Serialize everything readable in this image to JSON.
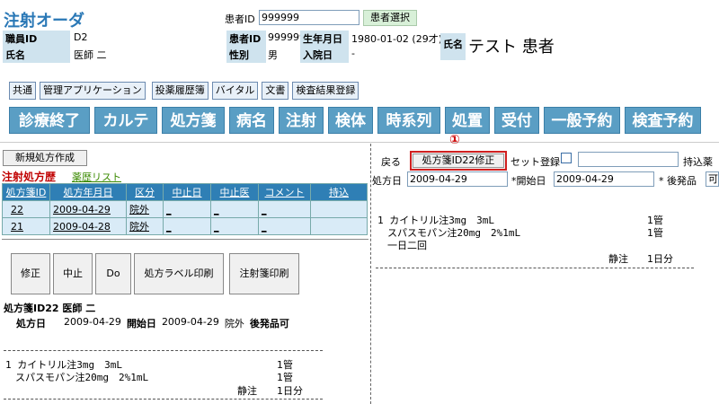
{
  "header": {
    "title": "注射オーダ",
    "patient_id_label": "患者ID",
    "patient_id_value": "999999",
    "patient_select_label": "患者選択",
    "staff_id_label": "職員ID",
    "staff_id_value": "D2",
    "staff_name_label": "氏名",
    "staff_name_value": "医師 二",
    "pid_label": "患者ID",
    "pid_value": "999999",
    "dob_label": "生年月日",
    "dob_value": "1980-01-02 (29才)",
    "sex_label": "性別",
    "sex_value": "男",
    "admit_label": "入院日",
    "admit_value": "-",
    "name_label": "氏名",
    "name_value": "テスト 患者"
  },
  "nav_small": [
    "共通",
    "管理アプリケーション",
    "投薬履歴簿",
    "バイタル",
    "文書",
    "検査結果登録"
  ],
  "nav_big": [
    "診療終了",
    "カルテ",
    "処方箋",
    "病名",
    "注射",
    "検体",
    "時系列",
    "処置",
    "受付",
    "一般予約",
    "検査予約"
  ],
  "left": {
    "new_rx_label": "新規処方作成",
    "history_title": "注射処方歴",
    "drug_list_link": "薬歴リスト",
    "columns": [
      "処方箋ID",
      "処方年月日",
      "区分",
      "中止日",
      "中止医",
      "コメント",
      "持込"
    ],
    "rows": [
      [
        "22",
        "2009-04-29",
        "院外",
        "_",
        "_",
        "_",
        ""
      ],
      [
        "21",
        "2009-04-28",
        "院外",
        "_",
        "_",
        "_",
        ""
      ]
    ],
    "actions": [
      "修正",
      "中止",
      "Do",
      "処方ラベル印刷",
      "注射箋印刷"
    ],
    "detail_title": "処方箋ID22 医師 二",
    "detail_rx_date_label": "処方日",
    "detail_rx_date": "2009-04-29",
    "detail_start_label": "開始日",
    "detail_start": "2009-04-29",
    "detail_division": "院外",
    "detail_generic": "後発品可",
    "lines": [
      {
        "text": "1 カイトリル注3mg　3mL",
        "qty": "1管"
      },
      {
        "text": "　スパスモパン注20mg　2%1mL",
        "qty": "1管"
      },
      {
        "text": "静注",
        "qty": "1日分"
      }
    ]
  },
  "right": {
    "back_label": "戻る",
    "modify_label": "処方箋ID22修正",
    "annotation": "①",
    "set_register_label": "セット登録",
    "bring_label": "持込薬",
    "rx_date_label": "処方日",
    "rx_date_value": "2009-04-29",
    "start_label": "*開始日",
    "start_value": "2009-04-29",
    "generic_label": "* 後発品",
    "generic_value": "可",
    "lines": [
      {
        "text": "1 カイトリル注3mg　3mL",
        "qty": "1管"
      },
      {
        "text": "　スパスモパン注20mg　2%1mL",
        "qty": "1管"
      },
      {
        "text": "　一日二回",
        "qty": ""
      },
      {
        "text": "静注",
        "qty": "1日分"
      }
    ]
  }
}
